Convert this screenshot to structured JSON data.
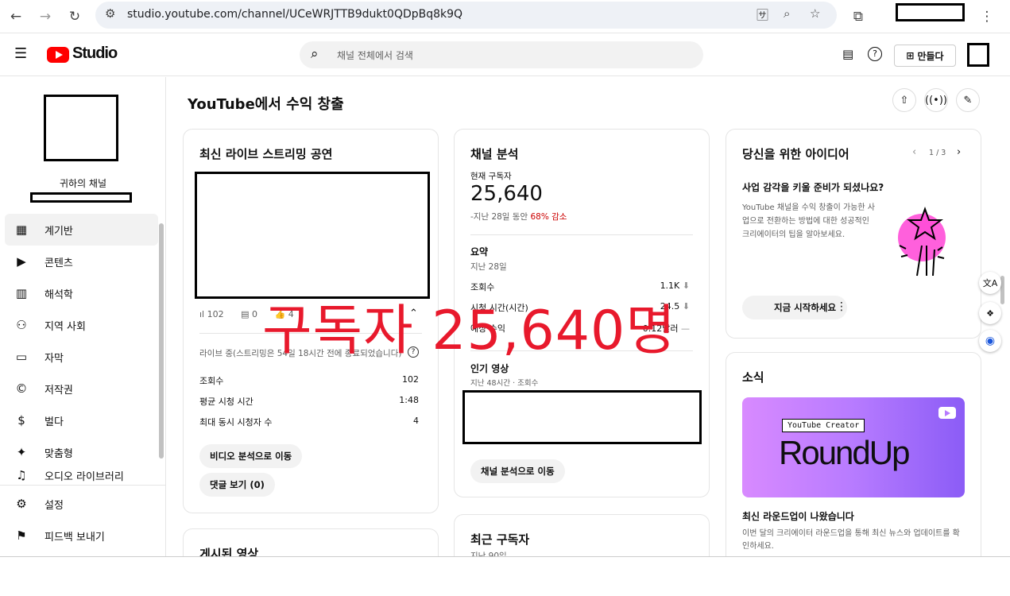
{
  "browser": {
    "url": "studio.youtube.com/channel/UCeWRJTTB9dukt0QDpBq8k9Q"
  },
  "app": {
    "logo_text": "Studio",
    "search_placeholder": "채널 전체에서 검색",
    "create_label": "만들다"
  },
  "sidebar": {
    "channel_title": "귀하의 채널",
    "items": [
      {
        "label": "계기반",
        "icon": "dashboard-icon"
      },
      {
        "label": "콘텐츠",
        "icon": "content-icon"
      },
      {
        "label": "해석학",
        "icon": "analytics-icon"
      },
      {
        "label": "지역 사회",
        "icon": "community-icon"
      },
      {
        "label": "자막",
        "icon": "subtitles-icon"
      },
      {
        "label": "저작권",
        "icon": "copyright-icon"
      },
      {
        "label": "벌다",
        "icon": "earn-icon"
      },
      {
        "label": "맞춤형",
        "icon": "customize-icon"
      },
      {
        "label": "오디오 라이브러리",
        "icon": "audio-library-icon"
      }
    ],
    "footer": [
      {
        "label": "설정",
        "icon": "settings-icon"
      },
      {
        "label": "피드백 보내기",
        "icon": "feedback-icon"
      }
    ]
  },
  "main": {
    "title": "YouTube에서 수익 창출"
  },
  "live": {
    "title": "최신 라이브 스트리밍 공연",
    "views_icon_count": "102",
    "comments": "0",
    "likes": "4",
    "status": "라이브 중(스트리밍은 54일 18시간 전에 종료되었습니다)",
    "rows": [
      {
        "label": "조회수",
        "value": "102"
      },
      {
        "label": "평균 시청 시간",
        "value": "1:48"
      },
      {
        "label": "최대 동시 시청자 수",
        "value": "4"
      }
    ],
    "btn_analytics": "비디오 분석으로 이동",
    "btn_comments": "댓글 보기 (0)"
  },
  "posted": {
    "title": "게시된 영상"
  },
  "analytics": {
    "title": "채널 분석",
    "subs_label": "현재 구독자",
    "subs_value": "25,640",
    "change_prefix": "-지난 28일 동안 ",
    "change_pct": "68% 감소",
    "summary_title": "요약",
    "summary_period": "지난 28일",
    "rows": [
      {
        "label": "조회수",
        "value": "1.1K"
      },
      {
        "label": "시청 시간(시간)",
        "value": "24.5"
      },
      {
        "label": "예상 수익",
        "value": "0.12달러"
      }
    ],
    "top_title": "인기 영상",
    "top_sub": "지난 48시간 · 조회수",
    "btn": "채널 분석으로 이동"
  },
  "recent": {
    "title": "최근 구독자",
    "sub": "지난 90일"
  },
  "ideas": {
    "title": "당신을 위한 아이디어",
    "pager": "1 / 3",
    "heading": "사업 감각을 키울 준비가 되셨나요?",
    "body": "YouTube 채널을 수익 창출이 가능한 사업으로 전환하는 방법에 대한 성공적인 크리에이터의 팁을 알아보세요.",
    "btn": "지금 시작하세요"
  },
  "news": {
    "title": "소식",
    "banner_tag": "YouTube Creator",
    "banner_big": "RoundUp",
    "heading": "최신 라운드업이 나왔습니다",
    "body": "이번 달의 크리에이터 라운드업을 통해 최신 뉴스와 업데이트를 확인하세요."
  },
  "overlay": {
    "text": "구독자 25,640명"
  }
}
